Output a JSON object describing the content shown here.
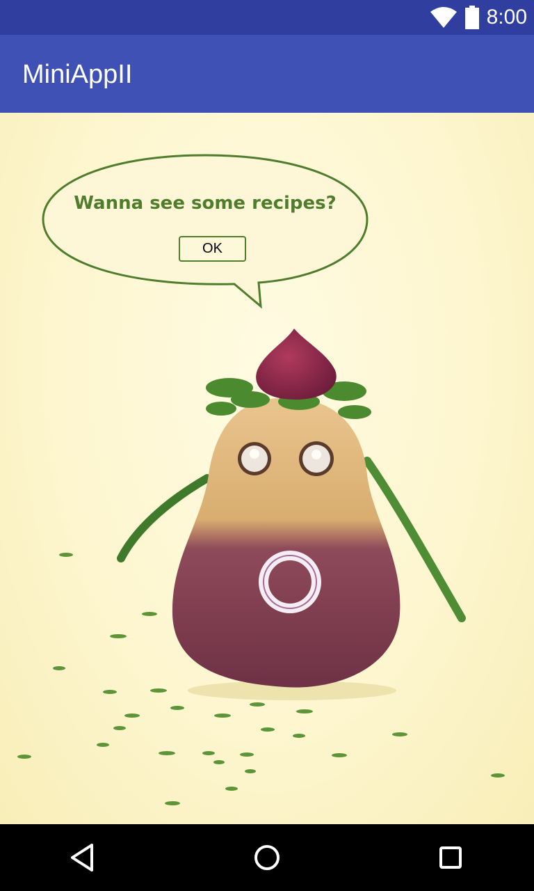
{
  "status_bar": {
    "time": "8:00",
    "icons": [
      "wifi-icon",
      "battery-icon"
    ]
  },
  "app_bar": {
    "title": "MiniAppII"
  },
  "speech_bubble": {
    "prompt": "Wanna see some recipes?",
    "button_label": "OK"
  },
  "nav_bar": {
    "buttons": [
      "back-icon",
      "home-icon",
      "recents-icon"
    ]
  },
  "colors": {
    "status_bar": "#303f9f",
    "app_bar": "#3f51b5",
    "bubble_green": "#4f7d2c",
    "background": "#fcf7d6"
  }
}
